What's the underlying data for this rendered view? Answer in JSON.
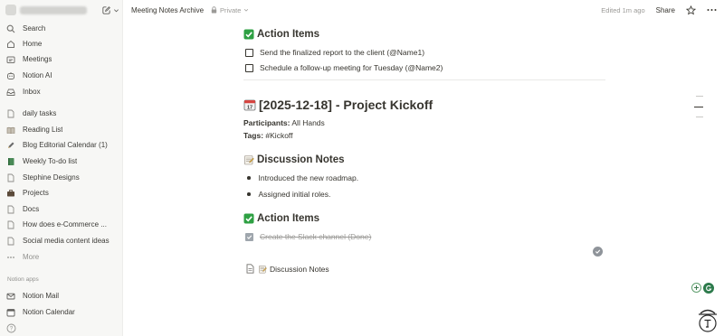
{
  "sidebar": {
    "workspace": {
      "avatar_icon": "workspace-avatar",
      "new_page_icon": "compose-icon",
      "dropdown_icon": "chevron-down-icon"
    },
    "main_items": [
      {
        "label": "Search",
        "icon": "search-icon"
      },
      {
        "label": "Home",
        "icon": "home-icon"
      },
      {
        "label": "Meetings",
        "icon": "meetings-icon"
      },
      {
        "label": "Notion AI",
        "icon": "notion-ai-icon"
      },
      {
        "label": "Inbox",
        "icon": "inbox-icon"
      }
    ],
    "pages": [
      {
        "label": "daily tasks",
        "icon": "page-icon"
      },
      {
        "label": "Reading List",
        "icon": "book-icon"
      },
      {
        "label": "Blog Editorial Calendar (1)",
        "icon": "pen-icon"
      },
      {
        "label": "Weekly To-do list",
        "icon": "notebook-icon"
      },
      {
        "label": "Stephine Designs",
        "icon": "page-icon"
      },
      {
        "label": "Projects",
        "icon": "briefcase-icon"
      },
      {
        "label": "Docs",
        "icon": "page-icon"
      },
      {
        "label": "How does e-Commerce ...",
        "icon": "page-icon"
      },
      {
        "label": "Social media content ideas",
        "icon": "page-icon"
      }
    ],
    "more_label": "More",
    "apps_section_label": "Notion apps",
    "apps": [
      {
        "label": "Notion Mail",
        "icon": "mail-icon"
      },
      {
        "label": "Notion Calendar",
        "icon": "calendar-icon"
      }
    ]
  },
  "topbar": {
    "breadcrumb": "Meeting Notes Archive",
    "privacy": "Private",
    "edited": "Edited 1m ago",
    "share_label": "Share"
  },
  "content": {
    "top_action_items": {
      "heading": "Action Items",
      "todos": [
        {
          "text": "Send the finalized report to the client (@Name1)",
          "checked": false
        },
        {
          "text": "Schedule a follow-up meeting for Tuesday (@Name2)",
          "checked": false
        }
      ]
    },
    "meeting_title": "[2025-12-18] - Project Kickoff",
    "participants_label": "Participants:",
    "participants_value": " All Hands",
    "tags_label": "Tags:",
    "tags_value": " #Kickoff",
    "discussion": {
      "heading": "Discussion Notes",
      "bullets": [
        "Introduced the new roadmap.",
        "Assigned initial roles."
      ]
    },
    "action_items": {
      "heading": "Action Items",
      "todos": [
        {
          "text": "Create the Slack channel (Done)",
          "checked": true
        }
      ]
    },
    "subpage_link": "Discussion Notes"
  },
  "colors": {
    "sidebar_bg": "#f7f7f5",
    "text": "#37352f",
    "muted": "#9b9a97",
    "check_green": "#2ea043"
  }
}
